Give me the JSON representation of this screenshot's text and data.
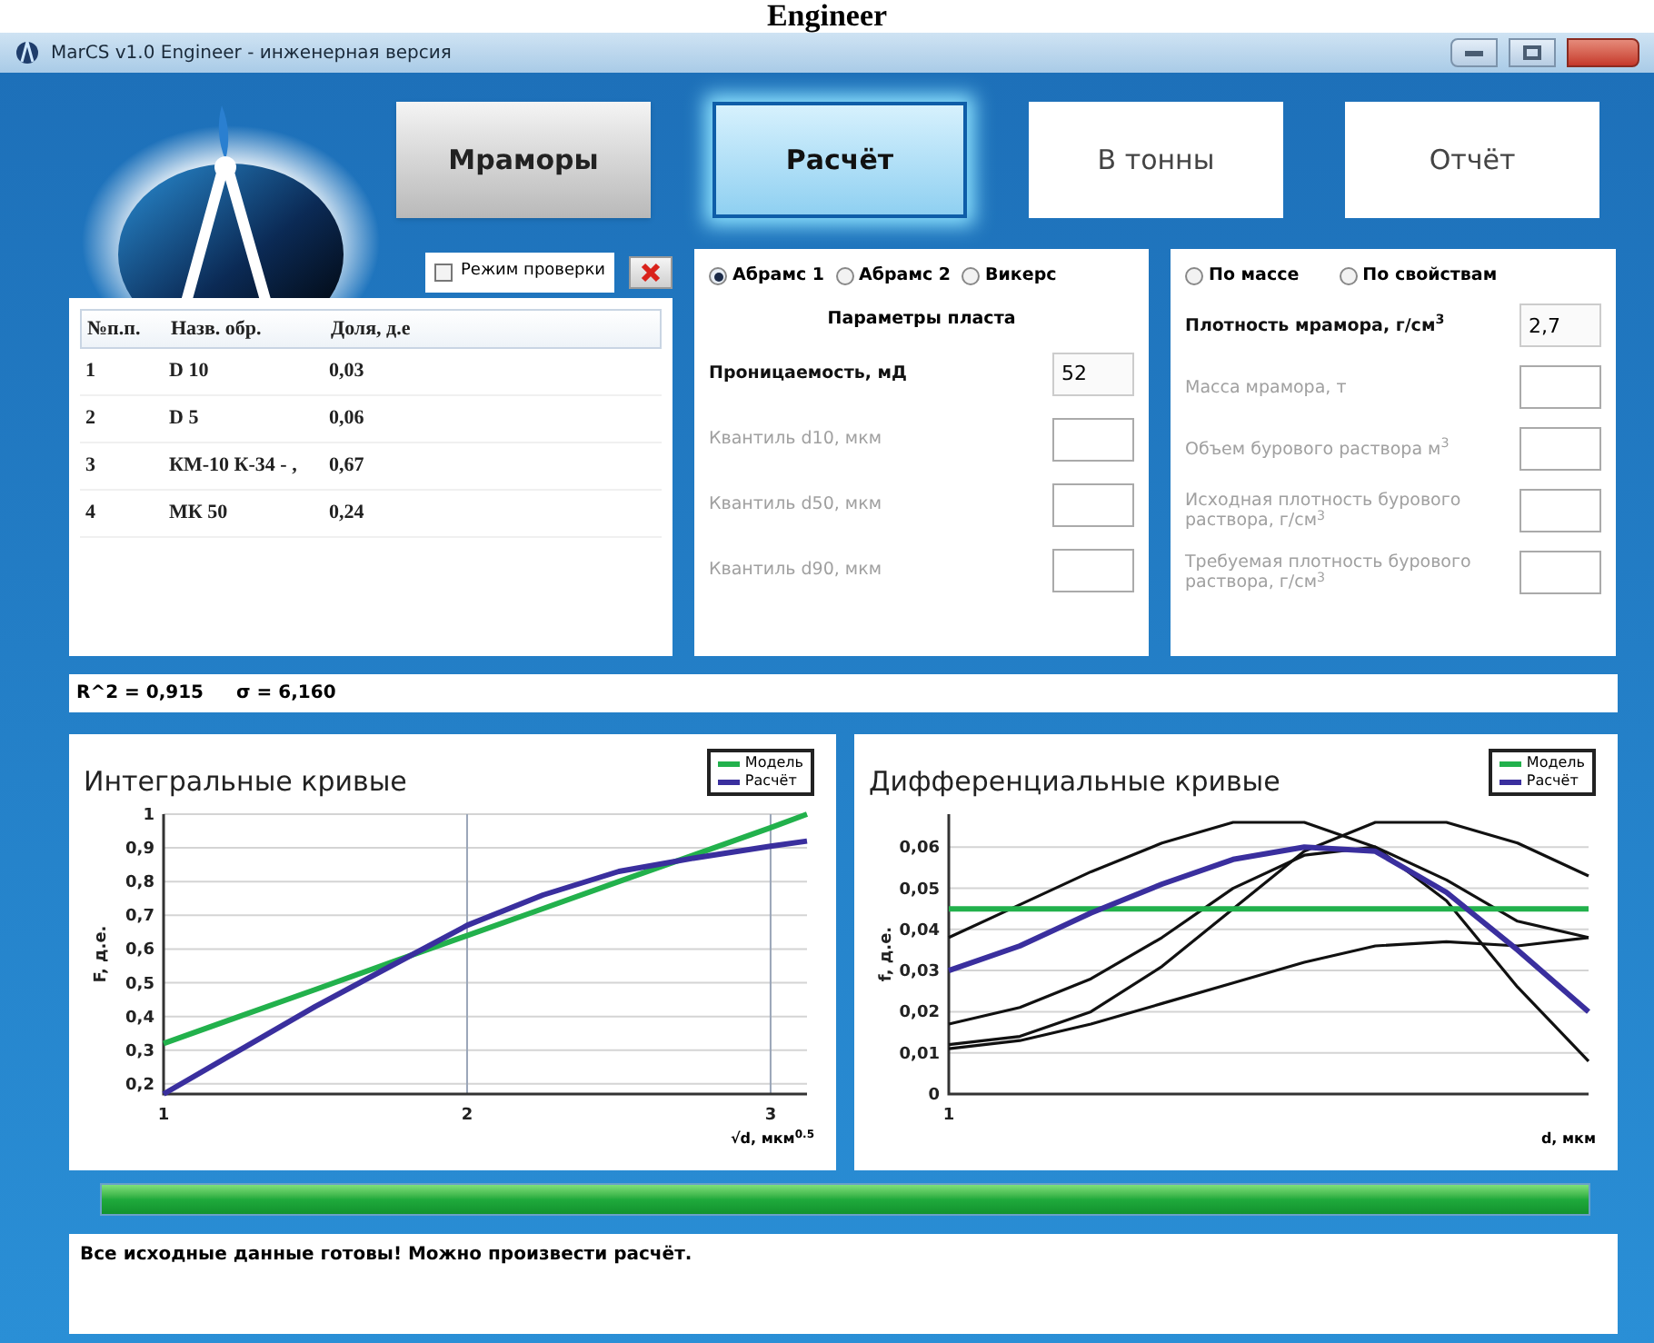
{
  "caption": "Engineer",
  "window": {
    "title": "MarCS v1.0 Engineer - инженерная версия"
  },
  "nav_buttons": [
    {
      "label": "Мраморы",
      "kind": "shaded",
      "selected": false
    },
    {
      "label": "Расчёт",
      "kind": "flat",
      "selected": true
    },
    {
      "label": "В тонны",
      "kind": "flat",
      "selected": false
    },
    {
      "label": "Отчёт",
      "kind": "flat",
      "selected": false
    }
  ],
  "check_mode": {
    "label": "Режим проверки",
    "checked": false
  },
  "samples_table": {
    "columns": [
      "№п.п.",
      "Назв. обр.",
      "Доля, д.е"
    ],
    "rows": [
      [
        "1",
        "D 10",
        "0,03"
      ],
      [
        "2",
        "D 5",
        "0,06"
      ],
      [
        "3",
        "КМ-10 К-34 - ,",
        "0,67"
      ],
      [
        "4",
        "МК 50",
        "0,24"
      ]
    ]
  },
  "method": {
    "options": [
      {
        "label": "Абрамс 1",
        "selected": true
      },
      {
        "label": "Абрамс 2",
        "selected": false
      },
      {
        "label": "Викерс",
        "selected": false
      }
    ],
    "heading": "Параметры пласта",
    "fields": [
      {
        "label": "Проницаемость, мД",
        "value": "52",
        "disabled": false
      },
      {
        "label": "Квантиль d10, мкм",
        "disabled": true
      },
      {
        "label": "Квантиль d50, мкм",
        "disabled": true
      },
      {
        "label": "Квантиль d90, мкм",
        "disabled": true
      }
    ]
  },
  "calc_mode": {
    "options": [
      {
        "label": "По массе",
        "selected": false
      },
      {
        "label": "По свойствам",
        "selected": false
      }
    ],
    "fields": [
      {
        "label": "Плотность мрамора, г/см$^{3}$",
        "value": "2,7",
        "disabled": false
      },
      {
        "label": "Масса мрамора, т",
        "disabled": true
      },
      {
        "label": "Объем бурового раствора м$^{3}$",
        "disabled": true
      },
      {
        "label": "Исходная плотность бурового раствора, г/см$^{3}$",
        "disabled": true
      },
      {
        "label": "Требуемая плотность бурового раствора, г/см$^{3}$",
        "disabled": true
      }
    ]
  },
  "fit_stats": [
    "R^2 = 0,915",
    "σ = 6,160"
  ],
  "charts": [
    {
      "chart_data": {
        "type": "line",
        "title": "Интегральные кривые",
        "xlabel": "√d, мкм$^{0.5}$",
        "ylabel": "F, д.е.",
        "x": [
          1,
          1.25,
          1.5,
          1.75,
          2,
          2.25,
          2.5,
          2.75,
          3,
          3.12
        ],
        "series": [
          {
            "name": "Модель",
            "color": "#22b14c",
            "values": [
              0.32,
              0.4,
              0.48,
              0.56,
              0.64,
              0.72,
              0.8,
              0.88,
              0.96,
              1.0
            ]
          },
          {
            "name": "Расчёт",
            "color": "#3a2f9e",
            "values": [
              0.17,
              0.3,
              0.43,
              0.55,
              0.67,
              0.76,
              0.83,
              0.87,
              0.905,
              0.92
            ]
          }
        ],
        "xlim": [
          1,
          3.12
        ],
        "ylim": [
          0.17,
          1
        ],
        "grid": true,
        "legend": true,
        "xticks": [
          1,
          2,
          3
        ],
        "yticks": [
          {
            "value": 0.2,
            "label": "0,2"
          },
          {
            "value": 0.3,
            "label": "0,3"
          },
          {
            "value": 0.4,
            "label": "0,4"
          },
          {
            "value": 0.5,
            "label": "0,5"
          },
          {
            "value": 0.6,
            "label": "0,6"
          },
          {
            "value": 0.7,
            "label": "0,7"
          },
          {
            "value": 0.8,
            "label": "0,8"
          },
          {
            "value": 0.9,
            "label": "0,9"
          },
          {
            "value": 1,
            "label": "1"
          }
        ]
      }
    },
    {
      "chart_data": {
        "type": "line",
        "title": "Дифференциальные кривые",
        "xlabel": "d, мкм",
        "ylabel": "f, д.е.",
        "series": [
          {
            "color": "#111111",
            "values": [
              0.038,
              0.046,
              0.054,
              0.061,
              0.066,
              0.066,
              0.06,
              0.047,
              0.026,
              0.008
            ]
          },
          {
            "color": "#111111",
            "values": [
              0.017,
              0.021,
              0.028,
              0.038,
              0.05,
              0.058,
              0.06,
              0.052,
              0.042,
              0.038
            ]
          },
          {
            "color": "#111111",
            "values": [
              0.012,
              0.014,
              0.02,
              0.031,
              0.045,
              0.059,
              0.066,
              0.066,
              0.061,
              0.053
            ]
          },
          {
            "color": "#111111",
            "values": [
              0.011,
              0.013,
              0.017,
              0.022,
              0.027,
              0.032,
              0.036,
              0.037,
              0.036,
              0.038
            ]
          },
          {
            "name": "Модель",
            "color": "#22b14c",
            "values": [
              0.045,
              0.045,
              0.045,
              0.045,
              0.045,
              0.045,
              0.045,
              0.045,
              0.045,
              0.045
            ]
          },
          {
            "name": "Расчёт",
            "color": "#3a2f9e",
            "values": [
              0.03,
              0.036,
              0.044,
              0.051,
              0.057,
              0.06,
              0.059,
              0.049,
              0.035,
              0.02
            ]
          }
        ],
        "ylim": [
          0,
          0.068
        ],
        "grid": true,
        "legend": true,
        "annotations": [
          {
            "text": "1"
          }
        ],
        "yticks": [
          {
            "value": 0,
            "label": "0"
          },
          {
            "value": 0.01,
            "label": "0,01"
          },
          {
            "value": 0.02,
            "label": "0,02"
          },
          {
            "value": 0.03,
            "label": "0,03"
          },
          {
            "value": 0.04,
            "label": "0,04"
          },
          {
            "value": 0.05,
            "label": "0,05"
          },
          {
            "value": 0.06,
            "label": "0,06"
          }
        ]
      }
    }
  ],
  "progress": {
    "level": 1
  },
  "message": "Все исходные данные готовы! Можно произвести расчёт."
}
